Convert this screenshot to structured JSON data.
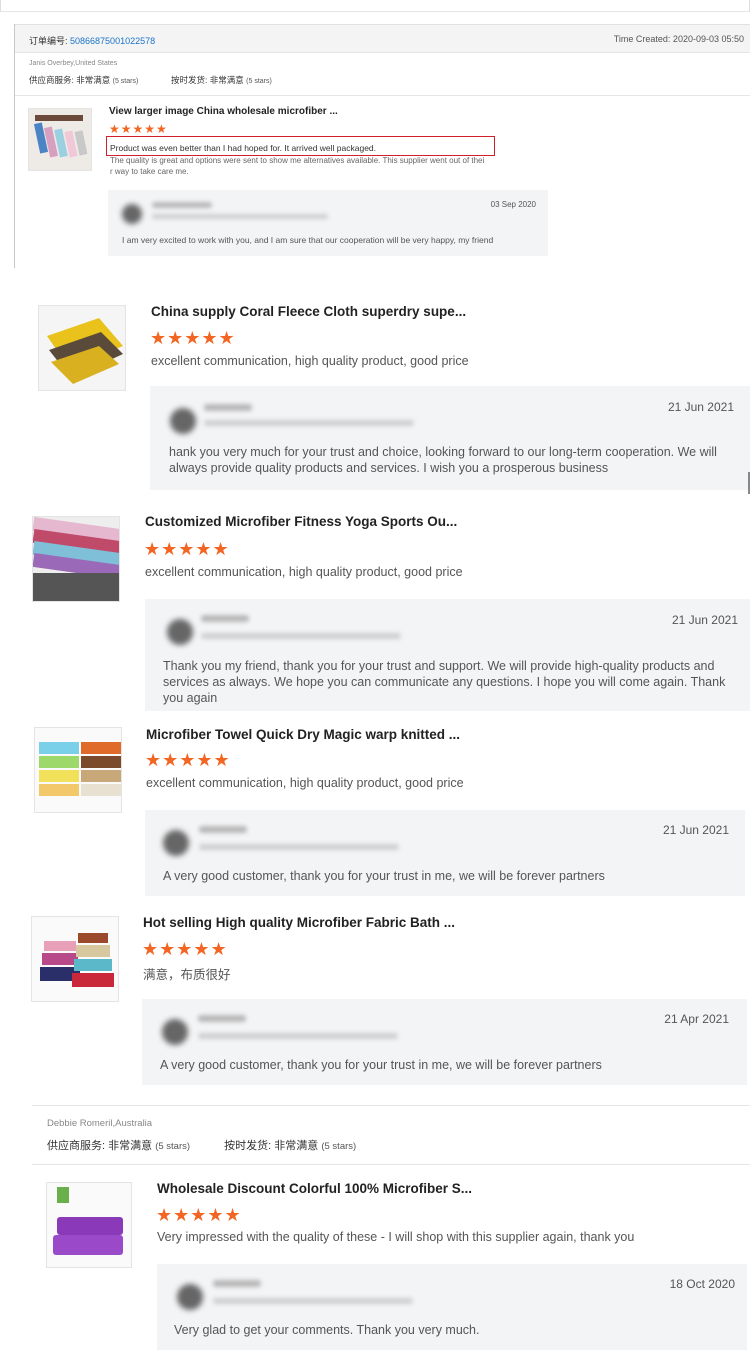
{
  "order": {
    "label": "订单编号: ",
    "number": "50866875001022578",
    "time_created": "Time Created: 2020-09-03 05:50"
  },
  "buyer1": {
    "name": "Janis Overbey,United States",
    "service_label": "供应商服务: ",
    "service_value": "非常满意",
    "service_stars": "(5 stars)",
    "shipping_label": "按时发货: ",
    "shipping_value": "非常满意",
    "shipping_stars": "(5 stars)"
  },
  "reviews": [
    {
      "title": "View larger image China wholesale microfiber ...",
      "stars": "★★★★★",
      "text_line1": "Product was even better than I had hoped for.  It arrived well packaged.",
      "text_line2": "The quality is great and options were sent to show me alternatives available.  This supplier went out of thei",
      "text_line3": "r way to take care me.",
      "reply_date": "03 Sep 2020",
      "reply_text": "I am very excited to work with you, and I am sure that our cooperation will be very happy, my friend"
    },
    {
      "title": "China supply Coral Fleece Cloth superdry supe...",
      "stars": "★★★★★",
      "text": "excellent communication, high quality product, good price",
      "reply_date": "21 Jun 2021",
      "reply_text": "hank you very much for your trust and choice, looking forward to our long-term cooperation. We will always provide quality products and services. I wish you a prosperous business"
    },
    {
      "title": "Customized Microfiber Fitness Yoga Sports Ou...",
      "stars": "★★★★★",
      "text": "excellent communication, high quality product, good price",
      "reply_date": "21 Jun 2021",
      "reply_text": "Thank you my friend, thank you for your trust and support. We will provide high-quality products and services as always. We hope you can communicate any questions. I hope you will come again. Thank you again"
    },
    {
      "title": "Microfiber Towel Quick Dry Magic warp knitted ...",
      "stars": "★★★★★",
      "text": "excellent communication, high quality product, good price",
      "reply_date": "21 Jun 2021",
      "reply_text": "A very good customer, thank you for your trust in me, we will be forever partners"
    },
    {
      "title": "Hot selling High quality Microfiber Fabric Bath ...",
      "stars": "★★★★★",
      "text": "满意，布质很好",
      "reply_date": "21 Apr 2021",
      "reply_text": "A very good customer, thank you for your trust in me, we will be forever partners"
    }
  ],
  "buyer2": {
    "name": "Debbie Romeril,Australia",
    "service_label": "供应商服务: ",
    "service_value": "非常满意",
    "service_stars": "(5 stars)",
    "shipping_label": "按时发货: ",
    "shipping_value": "非常满意",
    "shipping_stars": "(5 stars)"
  },
  "review_last": {
    "title": "Wholesale Discount Colorful 100% Microfiber S...",
    "stars": "★★★★★",
    "text": "Very impressed with the quality of these - I will shop with this supplier again, thank you",
    "reply_date": "18 Oct 2020",
    "reply_text": "Very glad to get your comments. Thank you very much."
  },
  "colors": {
    "star": "#f26522",
    "link": "#1a73c8",
    "highlight": "#d21f2c",
    "reply_bg": "#f3f4f6"
  }
}
